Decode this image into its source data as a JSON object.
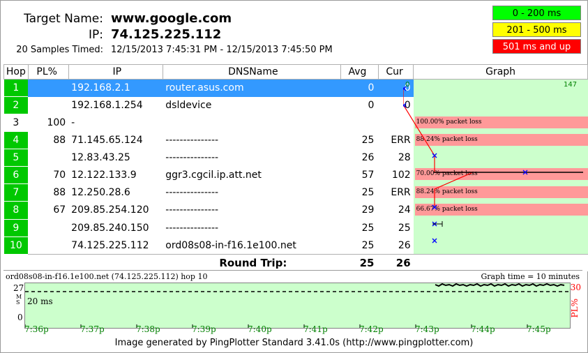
{
  "header": {
    "target_label": "Target Name:",
    "target_value": "www.google.com",
    "ip_label": "IP:",
    "ip_value": "74.125.225.112",
    "samples_label": "20 Samples Timed:",
    "samples_value": "12/15/2013 7:45:31 PM - 12/15/2013 7:45:50 PM"
  },
  "legend": [
    {
      "label": "0 - 200 ms",
      "color": "#00ff00"
    },
    {
      "label": "201 - 500 ms",
      "color": "#ffff00"
    },
    {
      "label": "501 ms and up",
      "color": "#ff0000"
    }
  ],
  "table": {
    "columns": [
      "Hop",
      "PL%",
      "IP",
      "DNSName",
      "Avg",
      "Cur",
      "Graph"
    ],
    "graph_scale_min": "0",
    "graph_scale_max": "147",
    "rows": [
      {
        "hop": "1",
        "pl": "",
        "ip": "192.168.2.1",
        "dns": "router.asus.com",
        "avg": "0",
        "cur": "0",
        "loss_label": "",
        "selected": true
      },
      {
        "hop": "2",
        "pl": "",
        "ip": "192.168.1.254",
        "dns": "dsldevice",
        "avg": "0",
        "cur": "0",
        "loss_label": ""
      },
      {
        "hop": "3",
        "pl": "100",
        "ip": "-",
        "dns": "",
        "avg": "",
        "cur": "",
        "loss_label": "100.00% packet loss"
      },
      {
        "hop": "4",
        "pl": "88",
        "ip": "71.145.65.124",
        "dns": "---------------",
        "avg": "25",
        "cur": "ERR",
        "loss_label": "88.24% packet loss"
      },
      {
        "hop": "5",
        "pl": "",
        "ip": "12.83.43.25",
        "dns": "---------------",
        "avg": "26",
        "cur": "28",
        "loss_label": ""
      },
      {
        "hop": "6",
        "pl": "70",
        "ip": "12.122.133.9",
        "dns": "ggr3.cgcil.ip.att.net",
        "avg": "57",
        "cur": "102",
        "loss_label": "70.00% packet loss"
      },
      {
        "hop": "7",
        "pl": "88",
        "ip": "12.250.28.6",
        "dns": "---------------",
        "avg": "25",
        "cur": "ERR",
        "loss_label": "88.24% packet loss"
      },
      {
        "hop": "8",
        "pl": "67",
        "ip": "209.85.254.120",
        "dns": "---------------",
        "avg": "29",
        "cur": "24",
        "loss_label": "66.67% packet loss"
      },
      {
        "hop": "9",
        "pl": "",
        "ip": "209.85.240.150",
        "dns": "---------------",
        "avg": "25",
        "cur": "25",
        "loss_label": ""
      },
      {
        "hop": "10",
        "pl": "",
        "ip": "74.125.225.112",
        "dns": "ord08s08-in-f16.1e100.net",
        "avg": "25",
        "cur": "26",
        "loss_label": ""
      }
    ],
    "round_trip_label": "Round Trip:",
    "round_trip_avg": "25",
    "round_trip_cur": "26"
  },
  "bottom_graph": {
    "caption": "ord08s08-in-f16.1e100.net (74.125.225.112) hop 10",
    "graph_time": "Graph time = 10 minutes",
    "y_max": "27",
    "y_min": "0",
    "ms_label": "MS",
    "threshold_label": "20 ms",
    "right_value": "30",
    "right_label": "PL%",
    "x_labels": [
      "7:36p",
      "7:37p",
      "7:38p",
      "7:39p",
      "7:40p",
      "7:41p",
      "7:42p",
      "7:43p",
      "7:44p",
      "7:45p"
    ]
  },
  "footer": "Image generated by PingPlotter Standard 3.41.0s (http://www.pingplotter.com)"
}
